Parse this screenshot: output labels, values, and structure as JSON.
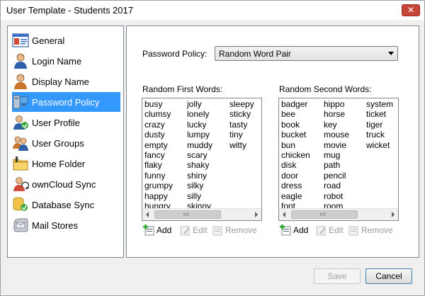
{
  "window": {
    "title": "User Template - Students 2017",
    "close_glyph": "✕"
  },
  "nav": {
    "items": [
      {
        "label": "General",
        "icon": "general-card-icon"
      },
      {
        "label": "Login Name",
        "icon": "login-user-icon"
      },
      {
        "label": "Display Name",
        "icon": "display-user-icon"
      },
      {
        "label": "Password Policy",
        "icon": "password-computer-icon",
        "selected": true
      },
      {
        "label": "User Profile",
        "icon": "user-profile-icon"
      },
      {
        "label": "User Groups",
        "icon": "user-groups-icon"
      },
      {
        "label": "Home Folder",
        "icon": "home-folder-icon"
      },
      {
        "label": "ownCloud Sync",
        "icon": "owncloud-sync-icon"
      },
      {
        "label": "Database Sync",
        "icon": "database-sync-icon"
      },
      {
        "label": "Mail Stores",
        "icon": "mail-stores-icon"
      }
    ]
  },
  "policy": {
    "label": "Password Policy:",
    "value": "Random Word Pair"
  },
  "first_words": {
    "label": "Random First Words:",
    "col1": [
      "busy",
      "clumsy",
      "crazy",
      "dusty",
      "empty",
      "fancy",
      "flaky",
      "funny",
      "grumpy",
      "happy",
      "hungry"
    ],
    "col2": [
      "jolly",
      "lonely",
      "lucky",
      "lumpy",
      "muddy",
      "scary",
      "shaky",
      "shiny",
      "silky",
      "silly",
      "skinny"
    ],
    "col3": [
      "sleepy",
      "sticky",
      "tasty",
      "tiny",
      "witty"
    ]
  },
  "second_words": {
    "label": "Random Second Words:",
    "col1": [
      "badger",
      "bee",
      "book",
      "bucket",
      "bun",
      "chicken",
      "disk",
      "door",
      "dress",
      "eagle",
      "font"
    ],
    "col2": [
      "hippo",
      "horse",
      "key",
      "mouse",
      "movie",
      "mug",
      "path",
      "pencil",
      "road",
      "robot",
      "room"
    ],
    "col3": [
      "system",
      "ticket",
      "tiger",
      "truck",
      "wicket"
    ]
  },
  "actions": {
    "add": "Add",
    "edit": "Edit",
    "remove": "Remove",
    "grip": "III"
  },
  "buttons": {
    "save": "Save",
    "cancel": "Cancel"
  }
}
